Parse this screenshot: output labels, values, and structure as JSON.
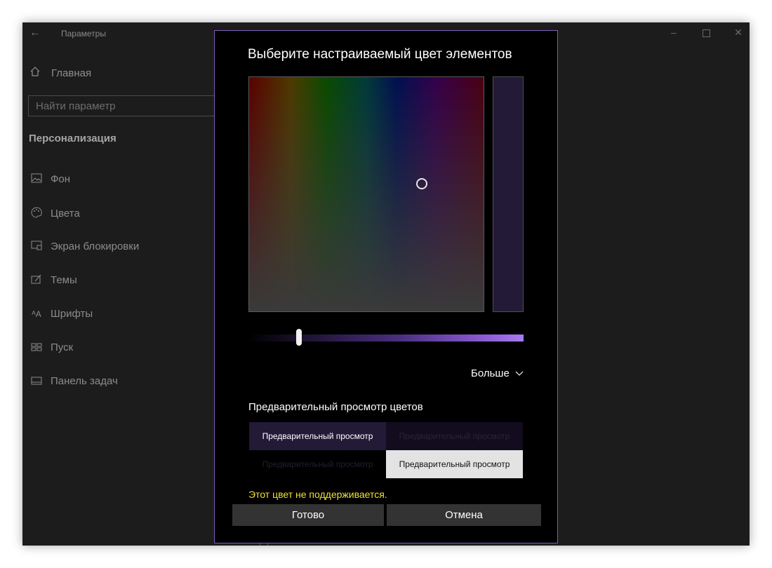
{
  "window": {
    "title": "Параметры",
    "controls": {
      "minimize": "–",
      "close": "✕"
    }
  },
  "sidebar": {
    "home_label": "Главная",
    "search_placeholder": "Найти параметр",
    "section_title": "Персонализация",
    "items": [
      {
        "label": "Фон",
        "icon": "image-icon"
      },
      {
        "label": "Цвета",
        "icon": "palette-icon"
      },
      {
        "label": "Экран блокировки",
        "icon": "lock-screen-icon"
      },
      {
        "label": "Темы",
        "icon": "themes-icon"
      },
      {
        "label": "Шрифты",
        "icon": "fonts-icon"
      },
      {
        "label": "Пуск",
        "icon": "start-icon"
      },
      {
        "label": "Панель задач",
        "icon": "taskbar-icon"
      }
    ]
  },
  "dialog": {
    "title": "Выберите настраиваемый цвет элементов",
    "selected_color": "#231a38",
    "accent_border": "#7e5bb8",
    "more_label": "Больше",
    "preview_heading": "Предварительный просмотр цветов",
    "preview_cells": [
      "Предварительный просмотр",
      "Предварительный просмотр",
      "Предварительный просмотр",
      "Предварительный просмотр"
    ],
    "warning": "Этот цвет не поддерживается.",
    "warning_color": "#f0e033",
    "ok_label": "Готово",
    "cancel_label": "Отмена"
  }
}
